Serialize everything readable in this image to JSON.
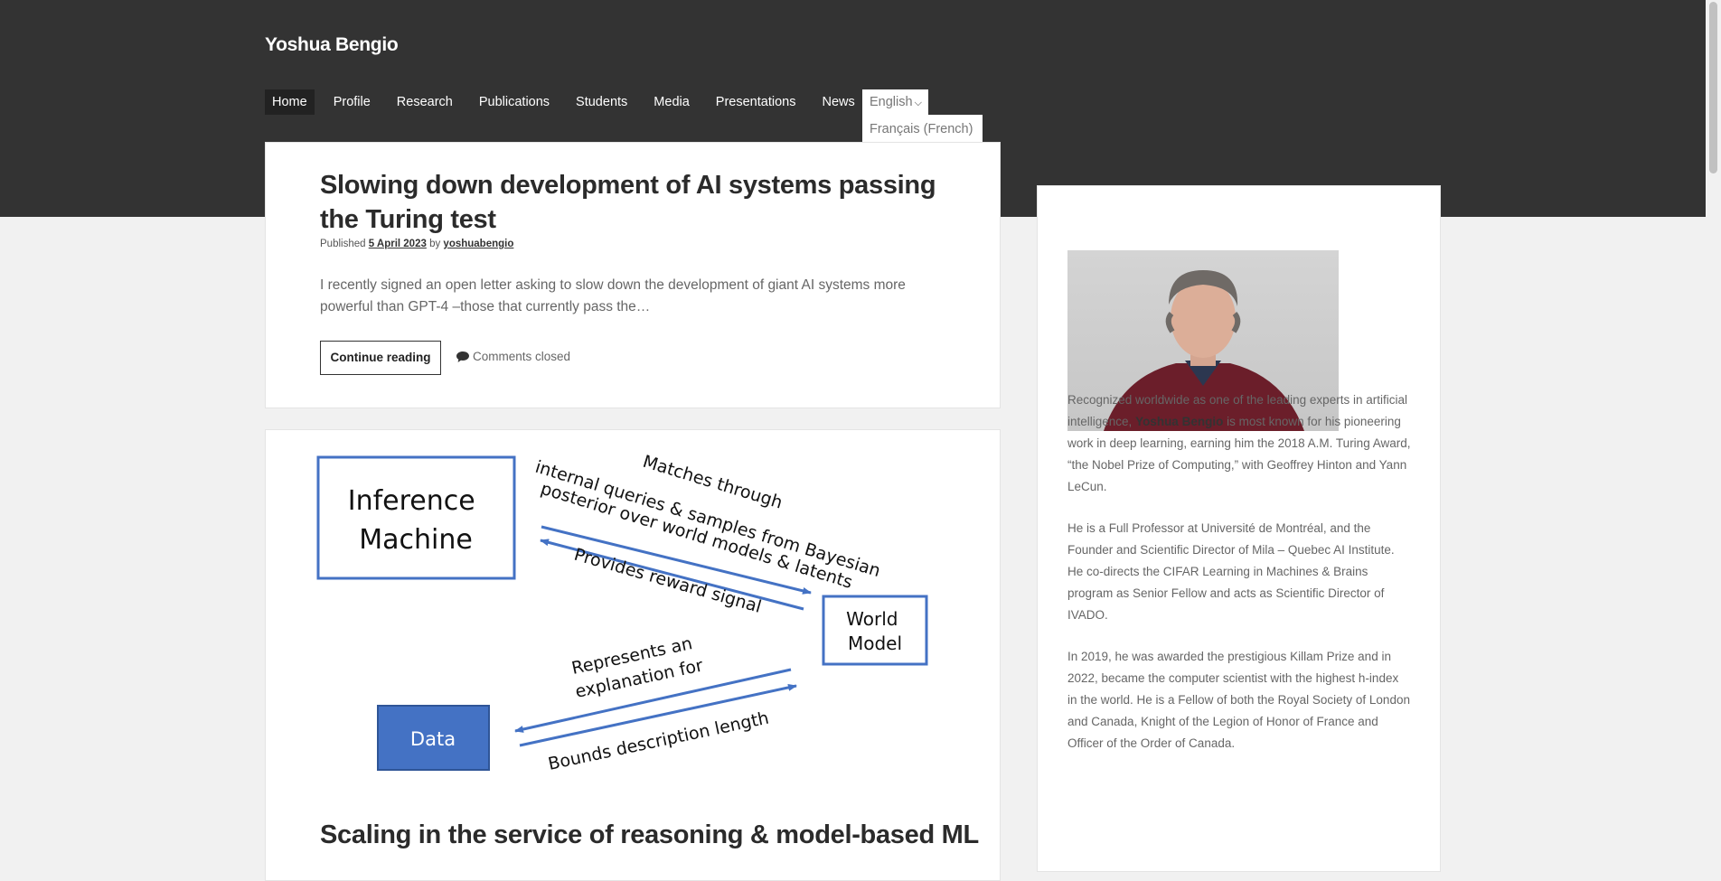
{
  "site": {
    "title": "Yoshua Bengio"
  },
  "nav": {
    "items": [
      "Home",
      "Profile",
      "Research",
      "Publications",
      "Students",
      "Media",
      "Presentations",
      "News"
    ],
    "language": {
      "current": "English",
      "option": "Français (French)"
    }
  },
  "post1": {
    "title": "Slowing down development of AI systems passing the Turing test",
    "published_prefix": "Published",
    "date": "5 April 2023",
    "by": "by",
    "author": "yoshuabengio",
    "excerpt": "I recently signed an open letter asking to slow down the development of giant AI systems more powerful than GPT-4  –those that currently pass the…",
    "continue_label": "Continue reading",
    "comments": "Comments closed"
  },
  "post2": {
    "title": "Scaling in the service of reasoning & model-based ML",
    "diagram": {
      "inference_machine": [
        "Inference",
        "Machine"
      ],
      "world_model": [
        "World",
        "Model"
      ],
      "data": "Data",
      "label_matches": [
        "Matches through",
        "internal queries & samples from Bayesian",
        "posterior over world models & latents"
      ],
      "label_reward": "Provides reward signal",
      "label_represents": [
        "Represents an",
        "explanation for"
      ],
      "label_bounds": "Bounds description length"
    }
  },
  "sidebar": {
    "photo_alt": "Yoshua Bengio",
    "p1_a": "Recognized worldwide as one of the leading experts in artificial intelligence, ",
    "p1_name": "Yoshua Bengio",
    "p1_b": " is most known for his pioneering work in deep learning, earning him the 2018 A.M. Turing Award, “the Nobel Prize of Computing,” with Geoffrey Hinton and Yann LeCun.",
    "p2": "He is a Full Professor at Université de Montréal, and the Founder and Scientific Director of Mila – Quebec AI Institute. He co-directs the CIFAR Learning in Machines & Brains program as Senior Fellow and acts as Scientific Director of IVADO.",
    "p3": "In 2019, he was awarded the prestigious Killam Prize and in 2022, became the computer scientist with the highest h-index in the world. He is a Fellow of both the Royal Society of London and Canada, Knight of the Legion of Honor of France and Officer of the Order of Canada."
  },
  "colors": {
    "header_bg": "#333333",
    "diagram_blue": "#4472c4",
    "page_bg": "#f1f1f1"
  }
}
